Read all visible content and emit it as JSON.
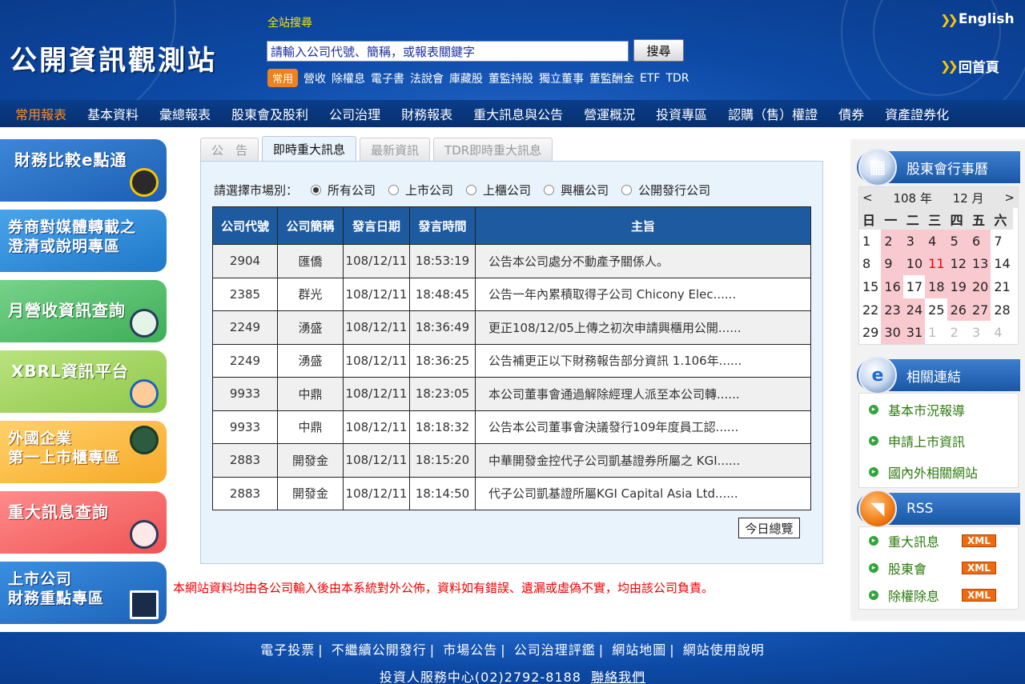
{
  "header": {
    "logo": "公開資訊觀測站",
    "search_title": "全站搜尋",
    "search_placeholder": "請輸入公司代號、簡稱，或報表關鍵字",
    "search_button": "搜尋",
    "quick_badge": "常用",
    "quick_links": [
      "營收",
      "除權息",
      "電子書",
      "法說會",
      "庫藏股",
      "董監持股",
      "獨立董事",
      "董監酬金",
      "ETF",
      "TDR"
    ],
    "english_label": "English",
    "home_label": "回首頁"
  },
  "nav": [
    "常用報表",
    "基本資料",
    "彙總報表",
    "股東會及股利",
    "公司治理",
    "財務報表",
    "重大訊息與公告",
    "營運概況",
    "投資專區",
    "認購（售）權證",
    "債券",
    "資產證券化"
  ],
  "left_banners": [
    {
      "label": "財務比較e點通"
    },
    {
      "label1": "券商對媒體轉載之",
      "label2": "澄清或說明專區"
    },
    {
      "label": "月營收資訊查詢"
    },
    {
      "label": "XBRL資訊平台"
    },
    {
      "label1": "外國企業",
      "label2": "第一上市櫃專區"
    },
    {
      "label": "重大訊息查詢"
    },
    {
      "label1": "上市公司",
      "label2": "財務重點專區"
    }
  ],
  "tabs": [
    "公　告",
    "即時重大訊息",
    "最新資訊",
    "TDR即時重大訊息"
  ],
  "market": {
    "label": "請選擇市場別：",
    "options": [
      "所有公司",
      "上市公司",
      "上櫃公司",
      "興櫃公司",
      "公開發行公司"
    ],
    "selected": "所有公司"
  },
  "table": {
    "headers": [
      "公司代號",
      "公司簡稱",
      "發言日期",
      "發言時間",
      "主旨"
    ],
    "rows": [
      [
        "2904",
        "匯僑",
        "108/12/11",
        "18:53:19",
        "公告本公司處分不動產予關係人。"
      ],
      [
        "2385",
        "群光",
        "108/12/11",
        "18:48:45",
        "公告一年內累積取得子公司 Chicony Elec......"
      ],
      [
        "2249",
        "湧盛",
        "108/12/11",
        "18:36:49",
        "更正108/12/05上傳之初次申請興櫃用公開......"
      ],
      [
        "2249",
        "湧盛",
        "108/12/11",
        "18:36:25",
        "公告補更正以下財務報告部分資訊 1.106年......"
      ],
      [
        "9933",
        "中鼎",
        "108/12/11",
        "18:23:05",
        "本公司董事會通過解除經理人派至本公司轉......"
      ],
      [
        "9933",
        "中鼎",
        "108/12/11",
        "18:18:32",
        "公告本公司董事會決議發行109年度員工認......"
      ],
      [
        "2883",
        "開發金",
        "108/12/11",
        "18:15:20",
        "中華開發金控代子公司凱基證券所屬之 KGI......"
      ],
      [
        "2883",
        "開發金",
        "108/12/11",
        "18:14:50",
        "代子公司凱基證所屬KGI Capital Asia Ltd......"
      ]
    ],
    "today_button": "今日總覽"
  },
  "disclaimer": "本網站資料均由各公司輸入後由本系統對外公佈，資料如有錯誤、遺漏或虛偽不實，均由該公司負責。",
  "calendar": {
    "title": "股東會行事曆",
    "year_label": "108 年",
    "month_label": "12 月",
    "prev": "<",
    "next": ">",
    "weekdays": [
      "日",
      "一",
      "二",
      "三",
      "四",
      "五",
      "六"
    ],
    "days": [
      [
        "1",
        "2",
        "3",
        "4",
        "5",
        "6",
        "7"
      ],
      [
        "8",
        "9",
        "10",
        "11",
        "12",
        "13",
        "14"
      ],
      [
        "15",
        "16",
        "17",
        "18",
        "19",
        "20",
        "21"
      ],
      [
        "22",
        "23",
        "24",
        "25",
        "26",
        "27",
        "28"
      ],
      [
        "29",
        "30",
        "31",
        "1",
        "2",
        "3",
        "4"
      ]
    ]
  },
  "related": {
    "title": "相關連結",
    "links": [
      "基本市況報導",
      "申請上市資訊",
      "國內外相關網站"
    ]
  },
  "rss": {
    "title": "RSS",
    "links": [
      "重大訊息",
      "股東會",
      "除權除息"
    ],
    "xml_label": "XML"
  },
  "footer": {
    "links": [
      "電子投票",
      "不繼續公開發行",
      "市場公告",
      "公司治理評鑑",
      "網站地圖",
      "網站使用說明"
    ],
    "contact": "投資人服務中心(02)2792-8188",
    "contact_link": "聯絡我們"
  },
  "colors": {
    "header_blue": "#0d4aa6",
    "nav_active": "#ff8c1a",
    "table_header": "#1e5aa0",
    "disclaimer_red": "#ee0000",
    "calendar_highlight": "#f8c9cf"
  }
}
